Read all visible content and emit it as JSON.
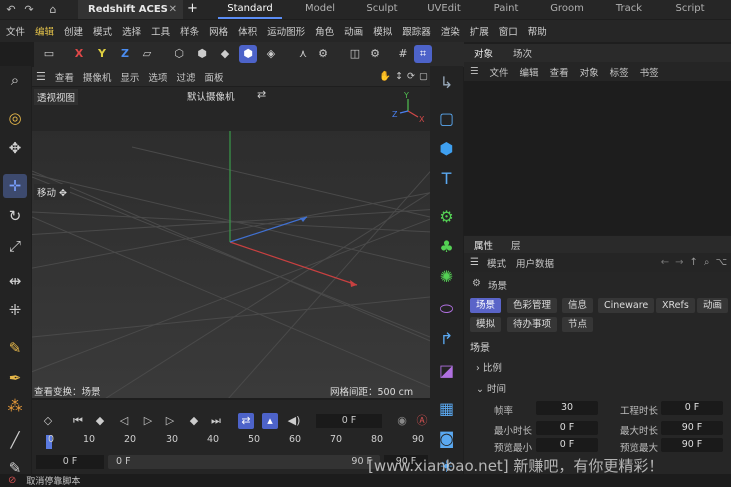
{
  "tabbar": {
    "document_tab": "Redshift ACES",
    "layouts": [
      "Standard",
      "Model",
      "Sculpt",
      "UVEdit",
      "Paint",
      "Groom",
      "Track",
      "Script"
    ],
    "active_layout": "Standard"
  },
  "menubar": {
    "items": [
      "文件",
      "编辑",
      "创建",
      "模式",
      "选择",
      "工具",
      "样条",
      "网格",
      "体积",
      "运动图形",
      "角色",
      "动画",
      "模拟",
      "跟踪器",
      "渲染",
      "扩展",
      "窗口",
      "帮助"
    ],
    "highlighted": "编辑"
  },
  "toolbar": {
    "axis_x": "X",
    "axis_y": "Y",
    "axis_z": "Z",
    "colors": {
      "x": "#e04848",
      "y": "#e0d040",
      "z": "#4a8cf0",
      "active": "#4d63c9"
    }
  },
  "viewport_menu": [
    "查看",
    "摄像机",
    "显示",
    "选项",
    "过滤",
    "面板"
  ],
  "viewport": {
    "view_name": "透视视图",
    "camera": "默认摄像机",
    "move_label": "移动",
    "view_transform": "查看变换：场景",
    "grid_spacing": "网格间距：500 cm",
    "gizmo": {
      "y": "Y",
      "x": "X",
      "z": "Z"
    }
  },
  "object_manager": {
    "tabs": [
      "对象",
      "场次"
    ],
    "menu": [
      "文件",
      "编辑",
      "查看",
      "对象",
      "标签",
      "书签"
    ]
  },
  "attributes": {
    "tabs": [
      "属性",
      "层"
    ],
    "menu": [
      "模式",
      "用户数据"
    ],
    "context": "场景",
    "chips_row1": [
      "场景",
      "色彩管理",
      "信息",
      "Cineware",
      "XRefs",
      "动画"
    ],
    "chips_row2": [
      "模拟",
      "待办事项",
      "节点"
    ],
    "section_title": "场景",
    "groups": [
      "比例",
      "时间"
    ],
    "fields": [
      {
        "label": "帧率",
        "value": "30"
      },
      {
        "label": "工程时长",
        "value": "0 F"
      },
      {
        "label": "最小时长",
        "value": "0 F"
      },
      {
        "label": "最大时长",
        "value": "90 F"
      },
      {
        "label": "预览最小",
        "value": "0 F"
      },
      {
        "label": "预览最大",
        "value": "90 F"
      }
    ]
  },
  "timeline": {
    "current_frame": "0 F",
    "ruler_ticks": [
      "0",
      "10",
      "20",
      "30",
      "40",
      "50",
      "60",
      "70",
      "80",
      "90"
    ],
    "start": "0 F",
    "range_start": "0 F",
    "range_end": "90 F",
    "end": "90 F"
  },
  "statusbar": {
    "text": "取消停靠脚本"
  },
  "watermark": "[www.xianbao.net] 新赚吧，有你更精彩！"
}
